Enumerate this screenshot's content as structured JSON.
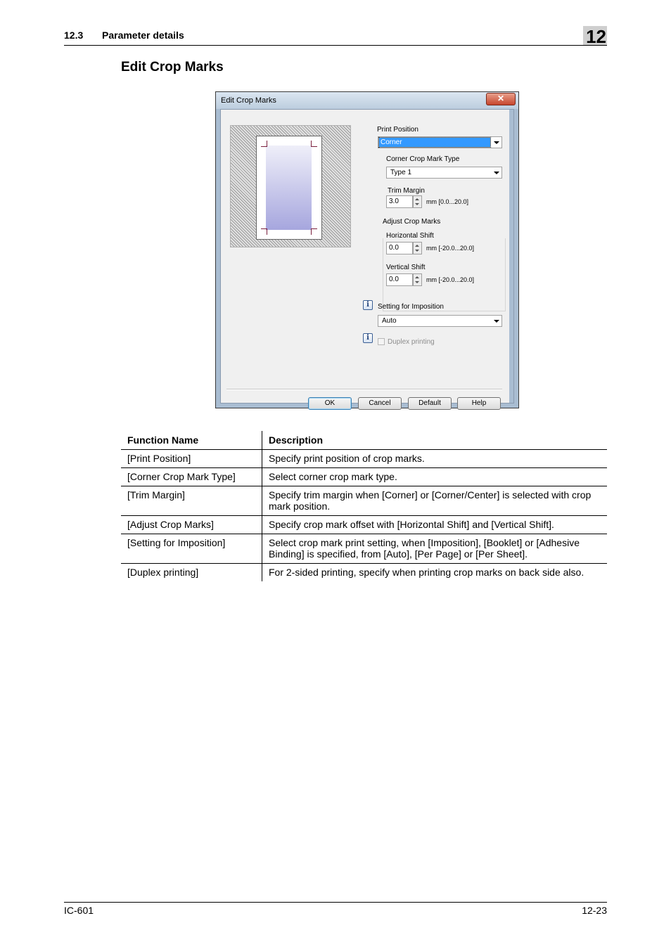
{
  "header": {
    "section_number": "12.3",
    "section_title": "Parameter details",
    "chapter": "12"
  },
  "page_title": "Edit Crop Marks",
  "dialog": {
    "title": "Edit Crop Marks",
    "close_glyph": "✕",
    "print_position": {
      "label": "Print Position",
      "value": "Corner"
    },
    "corner_crop_mark_type": {
      "label": "Corner Crop Mark Type",
      "value": "Type 1"
    },
    "trim_margin": {
      "label": "Trim Margin",
      "value": "3.0",
      "range": "mm [0.0...20.0]"
    },
    "adjust_crop_marks": {
      "label": "Adjust Crop Marks",
      "horizontal_shift": {
        "label": "Horizontal Shift",
        "value": "0.0",
        "range": "mm [-20.0...20.0]"
      },
      "vertical_shift": {
        "label": "Vertical Shift",
        "value": "0.0",
        "range": "mm [-20.0...20.0]"
      }
    },
    "setting_for_imposition": {
      "label": "Setting for Imposition",
      "value": "Auto"
    },
    "duplex_printing": {
      "label": "Duplex printing",
      "checked": false,
      "enabled": false
    },
    "info_glyph": "i",
    "buttons": {
      "ok": "OK",
      "cancel": "Cancel",
      "default": "Default",
      "help": "Help"
    }
  },
  "table": {
    "headers": [
      "Function Name",
      "Description"
    ],
    "rows": [
      [
        "[Print Position]",
        "Specify print position of crop marks."
      ],
      [
        "[Corner Crop Mark Type]",
        "Select corner crop mark type."
      ],
      [
        "[Trim Margin]",
        "Specify trim margin when [Corner] or [Corner/Center] is selected with crop mark position."
      ],
      [
        "[Adjust Crop Marks]",
        "Specify crop mark offset with [Horizontal Shift] and [Vertical Shift]."
      ],
      [
        "[Setting for Imposition]",
        "Select crop mark print setting, when [Imposition], [Booklet] or [Adhesive Binding] is specified, from [Auto], [Per Page] or [Per Sheet]."
      ],
      [
        "[Duplex printing]",
        "For 2-sided printing, specify when printing crop marks on back side also."
      ]
    ]
  },
  "footer": {
    "left": "IC-601",
    "right": "12-23"
  }
}
